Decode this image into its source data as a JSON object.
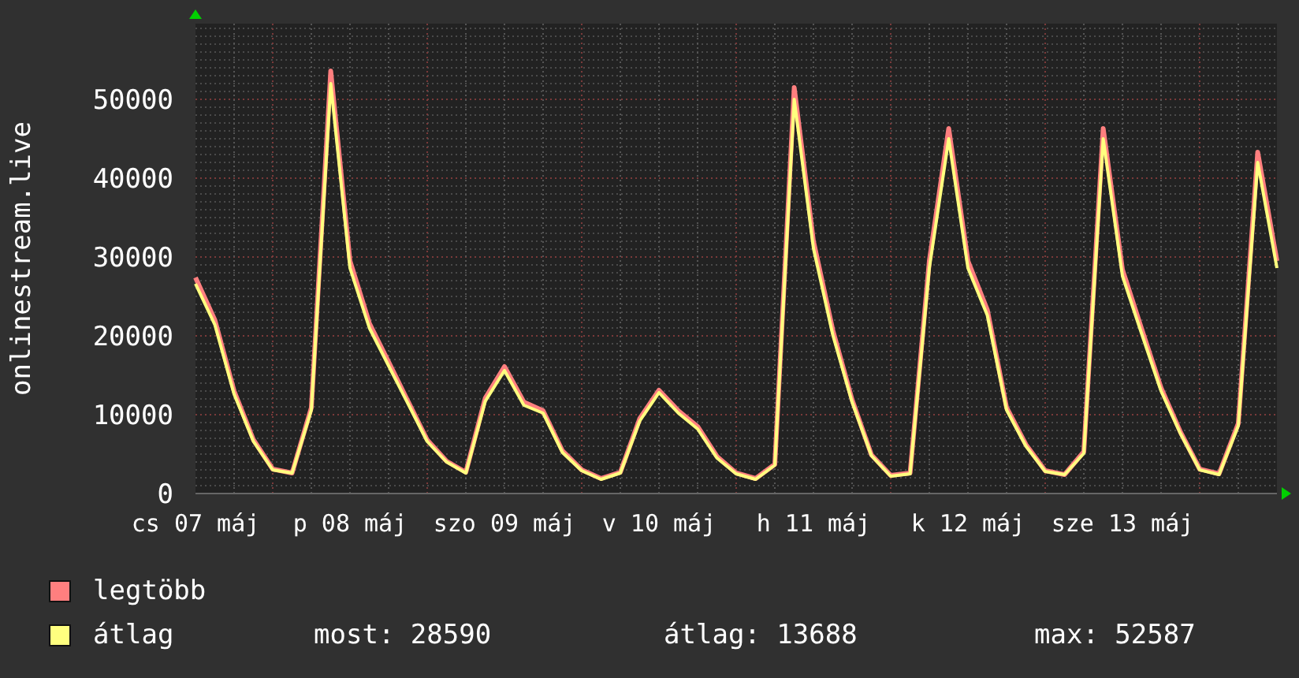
{
  "chart": {
    "chart_data": {
      "type": "line",
      "ylabel": "onlinestream.live",
      "grid": true,
      "ylim": [
        0,
        59600
      ],
      "categories": [
        "cs 07 máj",
        null,
        null,
        null,
        null,
        null,
        null,
        null,
        "p 08 máj",
        null,
        null,
        null,
        null,
        null,
        null,
        null,
        "szo 09 máj",
        null,
        null,
        null,
        null,
        null,
        null,
        null,
        "v 10 máj",
        null,
        null,
        null,
        null,
        null,
        null,
        null,
        "h 11 máj",
        null,
        null,
        null,
        null,
        null,
        null,
        null,
        "k 12 máj",
        null,
        null,
        null,
        null,
        null,
        null,
        null,
        "sze 13 máj",
        null,
        null,
        null,
        null,
        null,
        null,
        null,
        null
      ],
      "yticks": [
        0,
        10000,
        20000,
        30000,
        40000,
        50000
      ],
      "series": [
        {
          "name": "legtöbb",
          "color": "#ff7f7f",
          "values": [
            27400,
            22000,
            13000,
            6800,
            3100,
            2600,
            10900,
            53600,
            29500,
            21600,
            16700,
            11700,
            6800,
            4100,
            2700,
            12100,
            16100,
            11600,
            10500,
            5400,
            3000,
            1900,
            2700,
            9500,
            13100,
            10500,
            8500,
            4700,
            2600,
            1900,
            3700,
            51500,
            32000,
            20700,
            11900,
            4900,
            2300,
            2600,
            29500,
            46300,
            29500,
            23300,
            10900,
            6200,
            2900,
            2400,
            5300,
            46300,
            28400,
            20800,
            13400,
            7800,
            3100,
            2500,
            8900,
            43300,
            29500
          ]
        },
        {
          "name": "átlag",
          "color": "#ffff7f",
          "values": [
            26600,
            21400,
            12600,
            6600,
            3000,
            2600,
            10600,
            52000,
            28600,
            21000,
            16200,
            11400,
            6600,
            4000,
            2600,
            11700,
            15600,
            11200,
            10200,
            5200,
            2900,
            1800,
            2600,
            9200,
            12800,
            10200,
            8200,
            4500,
            2500,
            1800,
            3600,
            50000,
            31100,
            20100,
            11600,
            4800,
            2200,
            2500,
            28600,
            45000,
            28600,
            22600,
            10600,
            6000,
            2800,
            2400,
            5100,
            45000,
            27600,
            20200,
            13000,
            7600,
            3000,
            2400,
            8600,
            42000,
            28600
          ]
        }
      ]
    }
  },
  "legend": {
    "stats": [
      "most: 28590",
      "átlag: 13688",
      "max: 52587"
    ]
  }
}
